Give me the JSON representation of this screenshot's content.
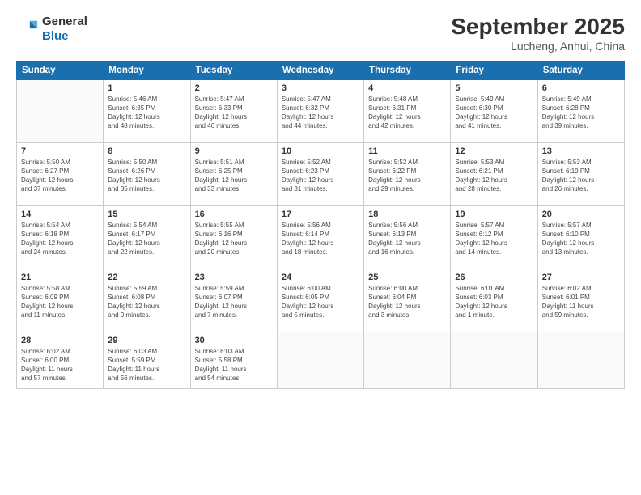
{
  "header": {
    "logo_line1": "General",
    "logo_line2": "Blue",
    "month": "September 2025",
    "location": "Lucheng, Anhui, China"
  },
  "weekdays": [
    "Sunday",
    "Monday",
    "Tuesday",
    "Wednesday",
    "Thursday",
    "Friday",
    "Saturday"
  ],
  "weeks": [
    [
      {
        "day": "",
        "info": ""
      },
      {
        "day": "1",
        "info": "Sunrise: 5:46 AM\nSunset: 6:35 PM\nDaylight: 12 hours\nand 48 minutes."
      },
      {
        "day": "2",
        "info": "Sunrise: 5:47 AM\nSunset: 6:33 PM\nDaylight: 12 hours\nand 46 minutes."
      },
      {
        "day": "3",
        "info": "Sunrise: 5:47 AM\nSunset: 6:32 PM\nDaylight: 12 hours\nand 44 minutes."
      },
      {
        "day": "4",
        "info": "Sunrise: 5:48 AM\nSunset: 6:31 PM\nDaylight: 12 hours\nand 42 minutes."
      },
      {
        "day": "5",
        "info": "Sunrise: 5:49 AM\nSunset: 6:30 PM\nDaylight: 12 hours\nand 41 minutes."
      },
      {
        "day": "6",
        "info": "Sunrise: 5:49 AM\nSunset: 6:28 PM\nDaylight: 12 hours\nand 39 minutes."
      }
    ],
    [
      {
        "day": "7",
        "info": "Sunrise: 5:50 AM\nSunset: 6:27 PM\nDaylight: 12 hours\nand 37 minutes."
      },
      {
        "day": "8",
        "info": "Sunrise: 5:50 AM\nSunset: 6:26 PM\nDaylight: 12 hours\nand 35 minutes."
      },
      {
        "day": "9",
        "info": "Sunrise: 5:51 AM\nSunset: 6:25 PM\nDaylight: 12 hours\nand 33 minutes."
      },
      {
        "day": "10",
        "info": "Sunrise: 5:52 AM\nSunset: 6:23 PM\nDaylight: 12 hours\nand 31 minutes."
      },
      {
        "day": "11",
        "info": "Sunrise: 5:52 AM\nSunset: 6:22 PM\nDaylight: 12 hours\nand 29 minutes."
      },
      {
        "day": "12",
        "info": "Sunrise: 5:53 AM\nSunset: 6:21 PM\nDaylight: 12 hours\nand 28 minutes."
      },
      {
        "day": "13",
        "info": "Sunrise: 5:53 AM\nSunset: 6:19 PM\nDaylight: 12 hours\nand 26 minutes."
      }
    ],
    [
      {
        "day": "14",
        "info": "Sunrise: 5:54 AM\nSunset: 6:18 PM\nDaylight: 12 hours\nand 24 minutes."
      },
      {
        "day": "15",
        "info": "Sunrise: 5:54 AM\nSunset: 6:17 PM\nDaylight: 12 hours\nand 22 minutes."
      },
      {
        "day": "16",
        "info": "Sunrise: 5:55 AM\nSunset: 6:16 PM\nDaylight: 12 hours\nand 20 minutes."
      },
      {
        "day": "17",
        "info": "Sunrise: 5:56 AM\nSunset: 6:14 PM\nDaylight: 12 hours\nand 18 minutes."
      },
      {
        "day": "18",
        "info": "Sunrise: 5:56 AM\nSunset: 6:13 PM\nDaylight: 12 hours\nand 16 minutes."
      },
      {
        "day": "19",
        "info": "Sunrise: 5:57 AM\nSunset: 6:12 PM\nDaylight: 12 hours\nand 14 minutes."
      },
      {
        "day": "20",
        "info": "Sunrise: 5:57 AM\nSunset: 6:10 PM\nDaylight: 12 hours\nand 13 minutes."
      }
    ],
    [
      {
        "day": "21",
        "info": "Sunrise: 5:58 AM\nSunset: 6:09 PM\nDaylight: 12 hours\nand 11 minutes."
      },
      {
        "day": "22",
        "info": "Sunrise: 5:59 AM\nSunset: 6:08 PM\nDaylight: 12 hours\nand 9 minutes."
      },
      {
        "day": "23",
        "info": "Sunrise: 5:59 AM\nSunset: 6:07 PM\nDaylight: 12 hours\nand 7 minutes."
      },
      {
        "day": "24",
        "info": "Sunrise: 6:00 AM\nSunset: 6:05 PM\nDaylight: 12 hours\nand 5 minutes."
      },
      {
        "day": "25",
        "info": "Sunrise: 6:00 AM\nSunset: 6:04 PM\nDaylight: 12 hours\nand 3 minutes."
      },
      {
        "day": "26",
        "info": "Sunrise: 6:01 AM\nSunset: 6:03 PM\nDaylight: 12 hours\nand 1 minute."
      },
      {
        "day": "27",
        "info": "Sunrise: 6:02 AM\nSunset: 6:01 PM\nDaylight: 11 hours\nand 59 minutes."
      }
    ],
    [
      {
        "day": "28",
        "info": "Sunrise: 6:02 AM\nSunset: 6:00 PM\nDaylight: 11 hours\nand 57 minutes."
      },
      {
        "day": "29",
        "info": "Sunrise: 6:03 AM\nSunset: 5:59 PM\nDaylight: 11 hours\nand 56 minutes."
      },
      {
        "day": "30",
        "info": "Sunrise: 6:03 AM\nSunset: 5:58 PM\nDaylight: 11 hours\nand 54 minutes."
      },
      {
        "day": "",
        "info": ""
      },
      {
        "day": "",
        "info": ""
      },
      {
        "day": "",
        "info": ""
      },
      {
        "day": "",
        "info": ""
      }
    ]
  ]
}
